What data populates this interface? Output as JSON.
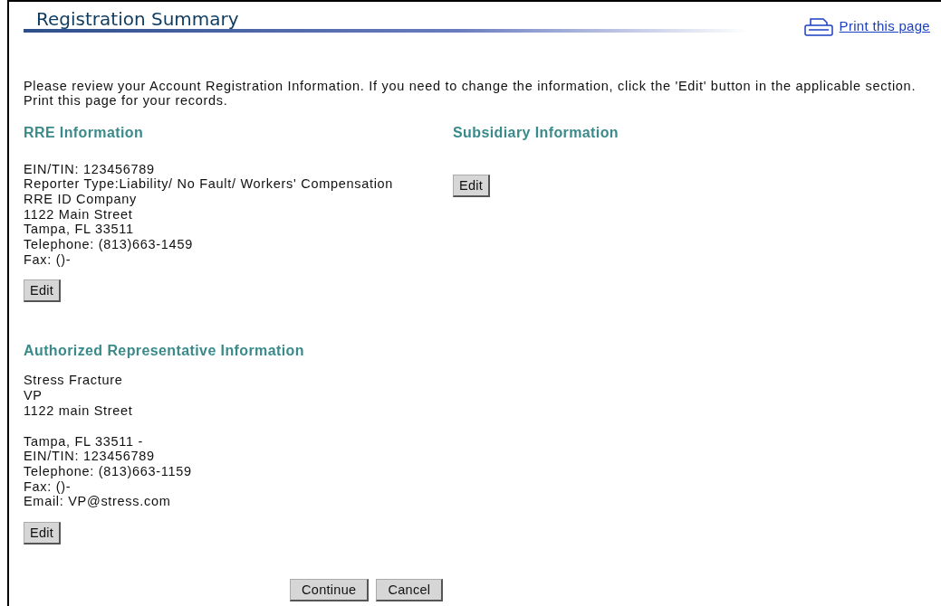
{
  "title": "Registration Summary",
  "print_link": "Print this page",
  "intro": "Please review your Account Registration Information. If you need to change the information, click the 'Edit' button in the applicable section. Print this page for your records.",
  "sections": [
    {
      "heading": "RRE Information",
      "paragraphs": [
        [
          "EIN/TIN: 123456789",
          "Reporter Type:Liability/ No Fault/ Workers' Compensation",
          "RRE ID Company",
          "1122 Main Street",
          "Tampa, FL 33511",
          "Telephone: (813)663-1459",
          "Fax: ()-"
        ]
      ],
      "button": "Edit"
    },
    {
      "heading": "Subsidiary Information",
      "button": "Edit"
    },
    {
      "heading": "Authorized Representative Information",
      "paragraphs": [
        [
          "Stress Fracture",
          "VP",
          "1122 main Street"
        ],
        [
          "Tampa, FL 33511 -",
          "EIN/TIN: 123456789",
          "Telephone: (813)663-1159",
          "Fax: ()-",
          "Email: VP@stress.com"
        ]
      ],
      "button": "Edit"
    }
  ],
  "buttons": [
    "Continue",
    "Cancel"
  ]
}
